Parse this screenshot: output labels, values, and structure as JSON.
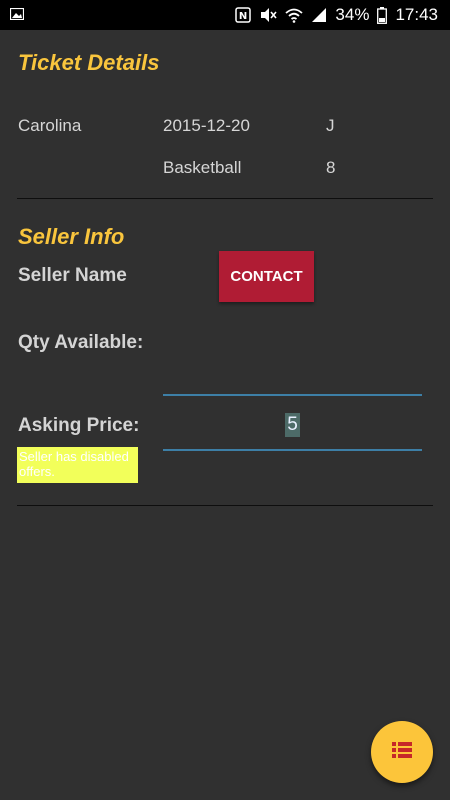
{
  "status_bar": {
    "battery": "34%",
    "time": "17:43"
  },
  "ticket_details": {
    "title": "Ticket Details",
    "team": "Carolina",
    "date": "2015-12-20",
    "section": "J",
    "sport": "Basketball",
    "row": "8"
  },
  "seller_info": {
    "title": "Seller Info",
    "seller_name_label": "Seller Name",
    "contact_label": "CONTACT",
    "qty_label": "Qty Available:",
    "qty_value": "",
    "price_label": "Asking Price:",
    "price_value": "5",
    "offer_note": "Seller has disabled offers."
  },
  "fab": {
    "icon": "list-icon"
  }
}
